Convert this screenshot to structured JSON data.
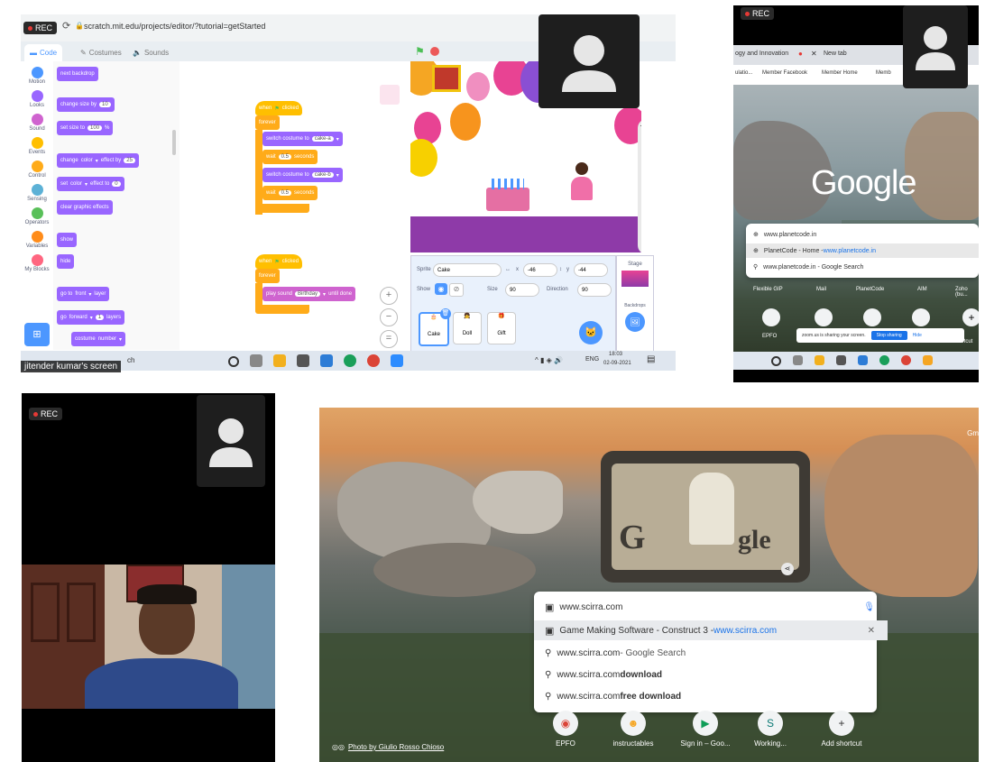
{
  "recording": {
    "label": "REC"
  },
  "scratch": {
    "url": "scratch.mit.edu/projects/editor/?tutorial=getStarted",
    "tabs": {
      "code": "Code",
      "costumes": "Costumes",
      "sounds": "Sounds"
    },
    "categories": [
      "Motion",
      "Looks",
      "Sound",
      "Events",
      "Control",
      "Sensing",
      "Operators",
      "Variables",
      "My Blocks"
    ],
    "palette": {
      "next_backdrop": "next backdrop",
      "change_size": "change size by",
      "change_size_val": "10",
      "set_size": "set size to",
      "set_size_val": "100",
      "percent": "%",
      "change_effect": "change",
      "color": "color",
      "effect_by": "effect by",
      "effect_val": "25",
      "set_effect": "set",
      "effect_to": "effect to",
      "set_effect_val": "0",
      "clear_effects": "clear graphic effects",
      "show": "show",
      "hide": "hide",
      "go_to": "go to",
      "front": "front",
      "layer": "layer",
      "go": "go",
      "forward": "forward",
      "layers_val": "1",
      "layers": "layers",
      "costume": "costume",
      "number": "number"
    },
    "script1": {
      "when_clicked": "when",
      "clicked": "clicked",
      "forever": "forever",
      "switch_costume": "switch costume to",
      "cake_a": "cake-a",
      "wait": "wait",
      "wait_val": "0.5",
      "seconds": "seconds",
      "cake_b": "cake-b"
    },
    "script2": {
      "when_clicked": "when",
      "clicked": "clicked",
      "forever": "forever",
      "play_sound": "play sound",
      "birthday": "Birthday",
      "until_done": "until done"
    },
    "sprite_pane": {
      "sprite_label": "Sprite",
      "sprite_name": "Cake",
      "x_label": "x",
      "x_val": "-46",
      "y_label": "y",
      "y_val": "-44",
      "show_label": "Show",
      "size_label": "Size",
      "size_val": "90",
      "direction_label": "Direction",
      "direction_val": "90",
      "sprites": [
        "Cake",
        "Doll",
        "Gift"
      ],
      "stage_label": "Stage",
      "backdrops_label": "Backdrops"
    },
    "taskbar": {
      "search_text": "ch",
      "lang": "ENG",
      "time": "18:03",
      "date": "02-09-2021"
    },
    "screen_label": "jitender kumar's screen"
  },
  "browser2": {
    "tab1": "ogy and Innovation",
    "tab2": "New tab",
    "bookmarks": [
      "ulatio...",
      "Member Facebook",
      "Member Home",
      "Memb"
    ],
    "logo": "Google",
    "omnibox_input": "www.planetcode.in",
    "suggestions": [
      {
        "title": "PlanetCode - Home - ",
        "link": "www.planetcode.in"
      },
      {
        "title": "www.planetcode.in - Google Search",
        "link": ""
      }
    ],
    "shortcuts": [
      "Flexible GIP",
      "Mail",
      "PlanetCode",
      "AIM",
      "Zoho (bu..."
    ],
    "shortcuts_row2": [
      "EPFO",
      "Add shortcut"
    ],
    "sharing_text": "zoom.us is sharing your screen.",
    "stop_sharing": "Stop sharing",
    "hide": "Hide"
  },
  "browser4": {
    "corner_text": "Gm",
    "omnibox_input": "www.scirra.com",
    "suggestions": [
      {
        "title": "Game Making Software - Construct 3 - ",
        "link": "www.scirra.com",
        "icon": "page-icon"
      },
      {
        "title": "www.scirra.com",
        "suffix": " - Google Search",
        "icon": "search-icon"
      },
      {
        "title": "www.scirra.com",
        "suffix": " download",
        "icon": "search-icon"
      },
      {
        "title": "www.scirra.com",
        "suffix": " free download",
        "icon": "search-icon"
      }
    ],
    "shortcuts": [
      "EPFO",
      "instructables",
      "Sign in – Goo...",
      "Working...",
      "Add shortcut"
    ],
    "photo_credit": "Photo by Giulio Rosso Chioso"
  },
  "colors": {
    "rec_dot": "#e53935",
    "scratch_blue": "#4c97ff",
    "looks_purple": "#9966ff",
    "events_yellow": "#ffbf00",
    "stage_floor": "#8e3aa8",
    "link_blue": "#1a73e8"
  }
}
